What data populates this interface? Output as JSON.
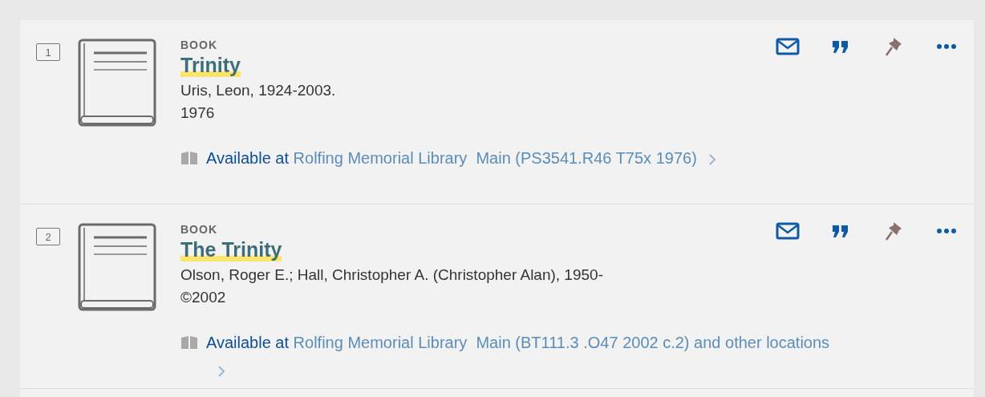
{
  "results": [
    {
      "number": "1",
      "type": "BOOK",
      "title": "Trinity",
      "author": "Uris, Leon, 1924-2003.",
      "date": "1976",
      "availability": {
        "status": "Available at",
        "location": "Rolfing Memorial Library  Main (PS3541.R46 T75x 1976)"
      }
    },
    {
      "number": "2",
      "type": "BOOK",
      "title": "The Trinity",
      "author": "Olson, Roger E.; Hall, Christopher A. (Christopher Alan), 1950-",
      "date": "©2002",
      "availability": {
        "status": "Available at",
        "location": "Rolfing Memorial Library  Main (BT111.3 .O47 2002 c.2) and other locations"
      }
    }
  ]
}
